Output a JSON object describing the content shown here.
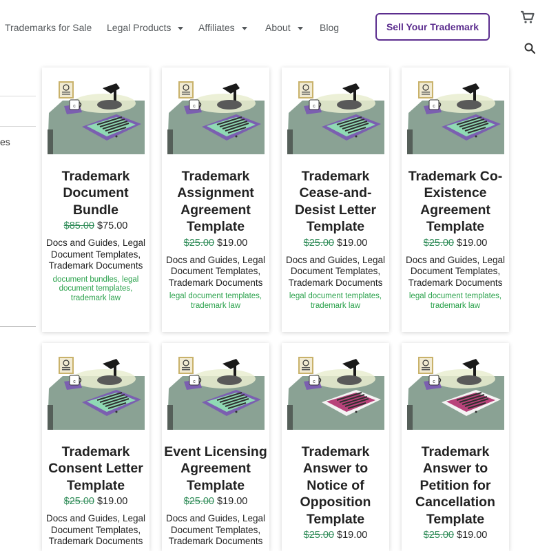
{
  "nav": {
    "items": [
      {
        "label": "Trademarks for Sale",
        "dropdown": false
      },
      {
        "label": "Legal Products",
        "dropdown": true
      },
      {
        "label": "Affiliates",
        "dropdown": true
      },
      {
        "label": "About",
        "dropdown": true
      },
      {
        "label": "Blog",
        "dropdown": false
      }
    ],
    "cta_label": "Sell Your Trademark"
  },
  "sidebar": {
    "partial_text": "es"
  },
  "colors": {
    "brand_purple": "#5b2d8e",
    "sale_green": "#2e8b57",
    "tag_green": "#2ba24c",
    "doc_green": "#8fd9b4",
    "doc_magenta": "#b8427a"
  },
  "products": [
    {
      "title": "Trademark Document Bundle",
      "old_price": "$85.00",
      "price": "$75.00",
      "categories": "Docs and Guides, Legal Document Templates, Trademark Documents",
      "tags": "document bundles, legal document templates, trademark law",
      "doc_color": "green"
    },
    {
      "title": "Trademark Assignment Agreement Template",
      "old_price": "$25.00",
      "price": "$19.00",
      "categories": "Docs and Guides, Legal Document Templates, Trademark Documents",
      "tags": "legal document templates, trademark law",
      "doc_color": "green"
    },
    {
      "title": "Trademark Cease-and-Desist Letter Template",
      "old_price": "$25.00",
      "price": "$19.00",
      "categories": "Docs and Guides, Legal Document Templates, Trademark Documents",
      "tags": "legal document templates, trademark law",
      "doc_color": "green"
    },
    {
      "title": "Trademark Co-Existence Agreement Template",
      "old_price": "$25.00",
      "price": "$19.00",
      "categories": "Docs and Guides, Legal Document Templates, Trademark Documents",
      "tags": "legal document templates, trademark law",
      "doc_color": "green"
    },
    {
      "title": "Trademark Consent Letter Template",
      "old_price": "$25.00",
      "price": "$19.00",
      "categories": "Docs and Guides, Legal Document Templates, Trademark Documents",
      "tags": "",
      "doc_color": "green"
    },
    {
      "title": "Event Licensing Agreement Template",
      "old_price": "$25.00",
      "price": "$19.00",
      "categories": "Docs and Guides, Legal Document Templates, Trademark Documents",
      "tags": "",
      "doc_color": "green"
    },
    {
      "title": "Trademark Answer to Notice of Opposition Template",
      "old_price": "$25.00",
      "price": "$19.00",
      "categories": "",
      "tags": "",
      "doc_color": "magenta"
    },
    {
      "title": "Trademark Answer to Petition for Cancellation Template",
      "old_price": "$25.00",
      "price": "$19.00",
      "categories": "",
      "tags": "",
      "doc_color": "magenta"
    }
  ]
}
